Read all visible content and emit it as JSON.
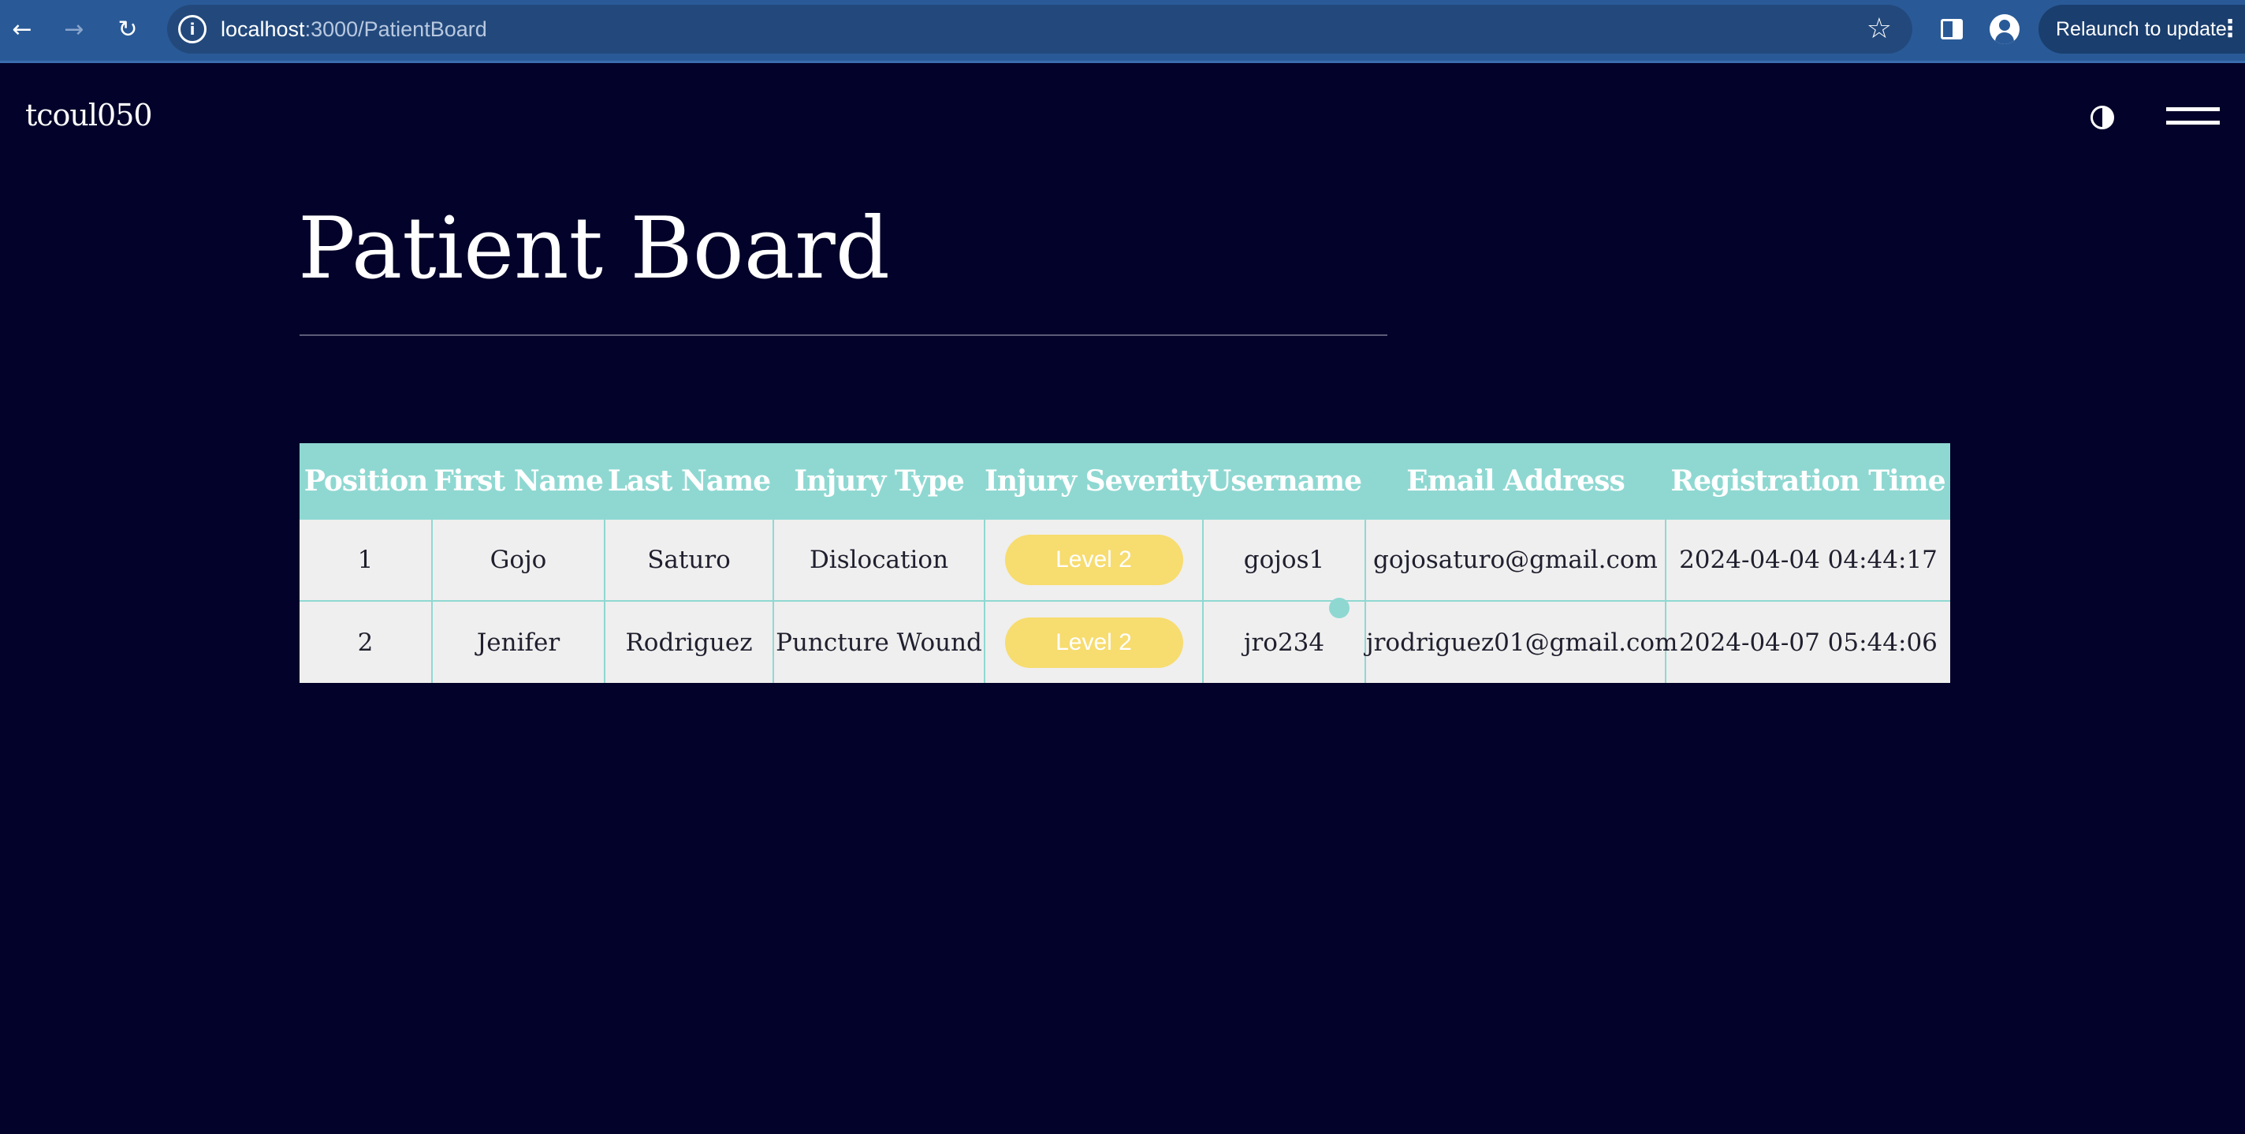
{
  "browser": {
    "url_host": "localhost",
    "url_path": ":3000/PatientBoard",
    "relaunch_label": "Relaunch to update"
  },
  "app": {
    "brand": "tcoul050"
  },
  "page": {
    "title": "Patient Board"
  },
  "table": {
    "columns": [
      "Position",
      "First Name",
      "Last Name",
      "Injury Type",
      "Injury Severity",
      "Username",
      "Email Address",
      "Registration Time"
    ],
    "rows": [
      {
        "position": "1",
        "first_name": "Gojo",
        "last_name": "Saturo",
        "injury_type": "Dislocation",
        "severity": "Level 2",
        "username": "gojos1",
        "email": "gojosaturo@gmail.com",
        "registration_time": "2024-04-04 04:44:17"
      },
      {
        "position": "2",
        "first_name": "Jenifer",
        "last_name": "Rodriguez",
        "injury_type": "Puncture Wound",
        "severity": "Level 2",
        "username": "jro234",
        "email": "jrodriguez01@gmail.com",
        "registration_time": "2024-04-07 05:44:06"
      }
    ]
  },
  "colors": {
    "page_background": "#03022a",
    "header_teal": "#8fd8d2",
    "severity_badge": "#f7dc6f",
    "browser_chrome": "#295a97"
  },
  "icons": [
    "back-arrow-icon",
    "forward-arrow-icon",
    "reload-icon",
    "site-info-icon",
    "bookmark-star-icon",
    "side-panel-icon",
    "profile-icon",
    "more-options-icon",
    "theme-toggle-icon",
    "hamburger-menu-icon"
  ]
}
